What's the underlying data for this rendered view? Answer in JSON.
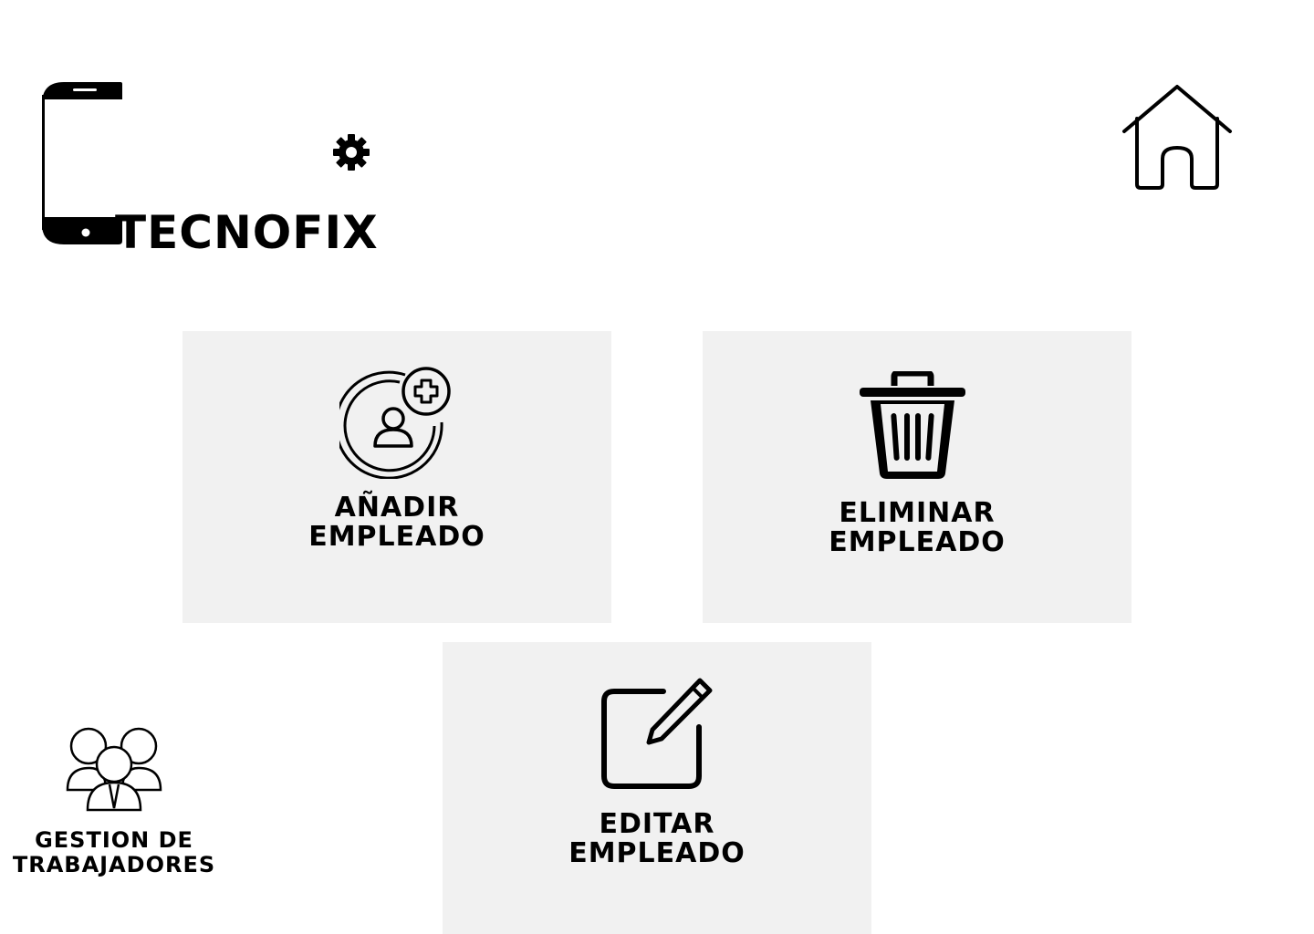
{
  "header": {
    "brand": "TECNOFIX",
    "logo_icons": [
      "phone-frame-icon",
      "gear-icon"
    ],
    "home_icon": "home-icon"
  },
  "cards": {
    "add": {
      "line1": "AÑADIR",
      "line2": "EMPLEADO",
      "icon": "add-user-icon"
    },
    "delete": {
      "line1": "ELIMINAR",
      "line2": "EMPLEADO",
      "icon": "trash-icon"
    },
    "edit": {
      "line1": "EDITAR",
      "line2": "EMPLEADO",
      "icon": "edit-icon"
    }
  },
  "section": {
    "line1": "GESTION DE",
    "line2": "TRABAJADORES",
    "icon": "workers-group-icon"
  },
  "colors": {
    "card_bg": "#f1f1f1",
    "text": "#000000",
    "page_bg": "#ffffff"
  }
}
